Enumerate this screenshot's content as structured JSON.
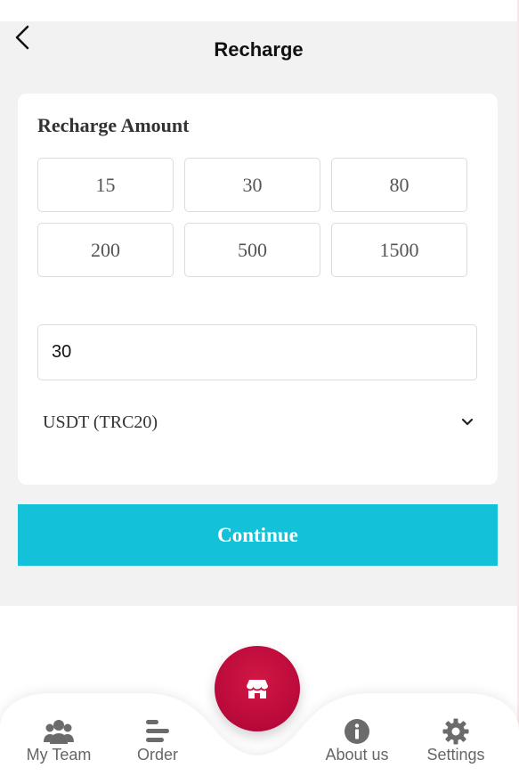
{
  "header": {
    "title": "Recharge",
    "back_icon": "chevron-left-icon"
  },
  "recharge": {
    "section_title": "Recharge Amount",
    "amounts": [
      "15",
      "30",
      "80",
      "200",
      "500",
      "1500"
    ],
    "input_value": "30",
    "currency_selected": "USDT (TRC20)",
    "currency_icon": "chevron-down-icon"
  },
  "continue_label": "Continue",
  "colors": {
    "accent": "#13c2d9",
    "center_button": "#b8093a",
    "background": "#f2f2f2"
  },
  "bottom_nav": {
    "items": [
      {
        "label": "My Team",
        "icon": "team-icon"
      },
      {
        "label": "Order",
        "icon": "order-icon"
      },
      {
        "label": "About us",
        "icon": "info-icon"
      },
      {
        "label": "Settings",
        "icon": "gear-icon"
      }
    ],
    "center_icon": "store-icon"
  }
}
